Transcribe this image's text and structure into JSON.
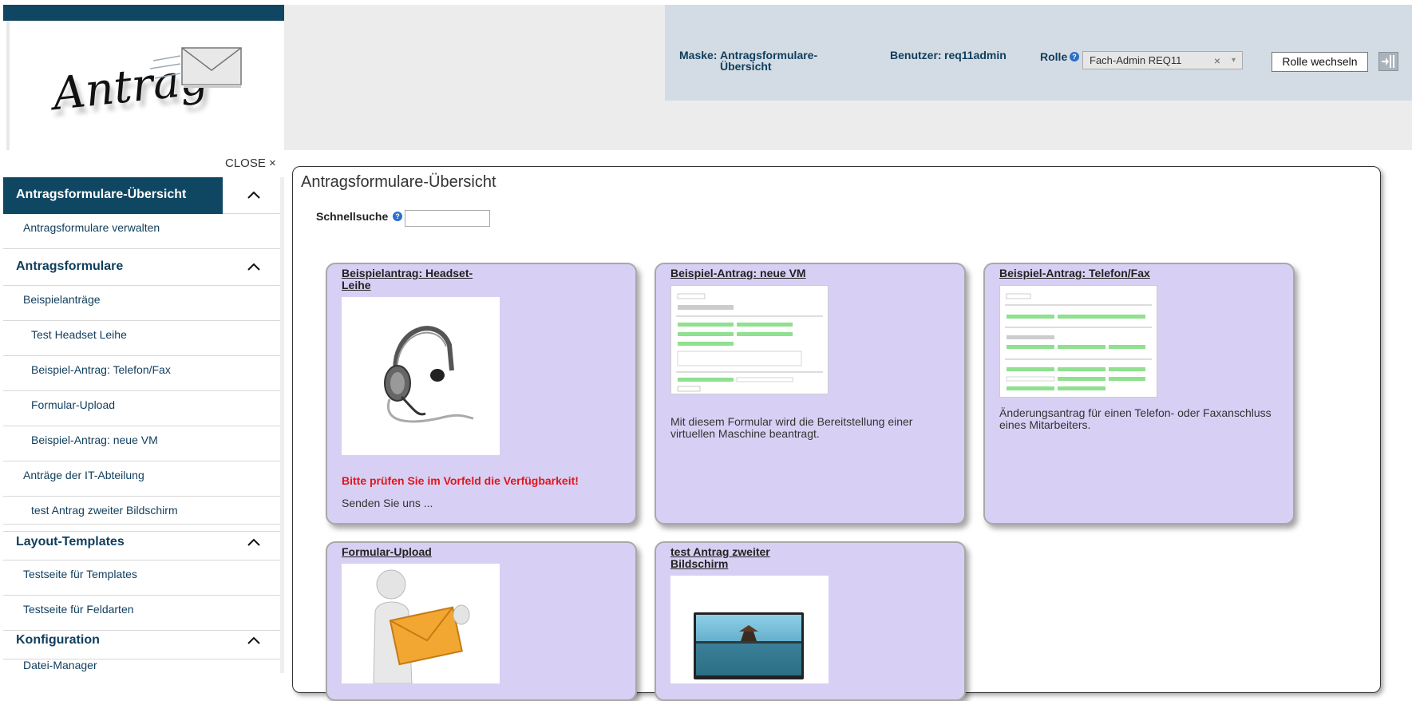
{
  "header": {
    "logo_text": "Antrag",
    "mask_label": "Maske:",
    "mask_value": "Antragsformulare-Übersicht",
    "user_label": "Benutzer:",
    "user_value": "req11admin",
    "role_label": "Rolle",
    "role_help": "?",
    "role_value": "Fach-Admin REQ11",
    "role_clear": "×",
    "role_arrow": "▾",
    "role_switch_label": "Rolle wechseln",
    "logout_icon": "logout-icon"
  },
  "sidebar": {
    "close_label": "CLOSE ×",
    "sections": [
      {
        "title": "Antragsformulare-Übersicht",
        "active": true,
        "items": [
          "Antragsformulare verwalten"
        ]
      },
      {
        "title": "Antragsformulare",
        "items": [
          "Beispielanträge",
          "Test Headset Leihe",
          "Beispiel-Antrag: Telefon/Fax",
          "Formular-Upload",
          "Beispiel-Antrag: neue VM",
          "Anträge der IT-Abteilung",
          "test Antrag zweiter Bildschirm"
        ]
      },
      {
        "title": "Layout-Templates",
        "items": [
          "Testseite für Templates",
          "Testseite für Feldarten"
        ]
      },
      {
        "title": "Konfiguration",
        "items": [
          "Datei-Manager"
        ]
      }
    ]
  },
  "main": {
    "title": "Antragsformulare-Übersicht",
    "quick_search_label": "Schnellsuche",
    "quick_search_help": "?",
    "quick_search_value": "",
    "cards": [
      {
        "title": "Beispielantrag: Headset-Leihe",
        "warning": "Bitte prüfen Sie im Vorfeld die Verfügbarkeit!",
        "description": "Senden Sie uns ..."
      },
      {
        "title": "Beispiel-Antrag: neue VM",
        "description": "Mit diesem Formular wird die Bereitstellung einer virtuellen Maschine beantragt."
      },
      {
        "title": "Beispiel-Antrag: Telefon/Fax",
        "description": "Änderungsantrag für einen Telefon- oder Faxanschluss eines Mitarbeiters."
      },
      {
        "title": "Formular-Upload",
        "description": ""
      },
      {
        "title": "test Antrag zweiter Bildschirm",
        "description": ""
      }
    ]
  },
  "colors": {
    "brand_dark": "#0f4763",
    "card_bg": "#d8d0f4",
    "warning": "#e0161d",
    "header_info_bg": "#d3dce4"
  }
}
